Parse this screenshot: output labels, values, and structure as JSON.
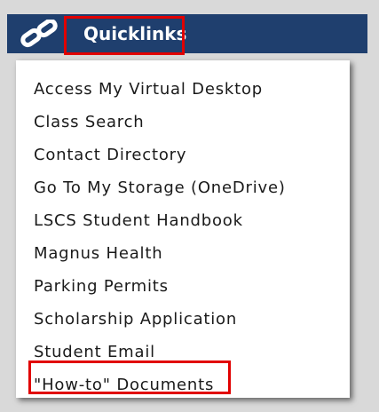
{
  "header": {
    "title": "Quicklinks",
    "icon": "link-chain-icon",
    "background_color": "#1f3f6e",
    "highlight_color": "#e10000"
  },
  "links": [
    {
      "label": "Access My Virtual Desktop"
    },
    {
      "label": "Class Search"
    },
    {
      "label": "Contact Directory"
    },
    {
      "label": "Go To My Storage (OneDrive)"
    },
    {
      "label": "LSCS Student Handbook"
    },
    {
      "label": "Magnus Health"
    },
    {
      "label": "Parking Permits"
    },
    {
      "label": "Scholarship Application"
    },
    {
      "label": "Student Email"
    },
    {
      "label": "\"How-to\" Documents"
    }
  ]
}
